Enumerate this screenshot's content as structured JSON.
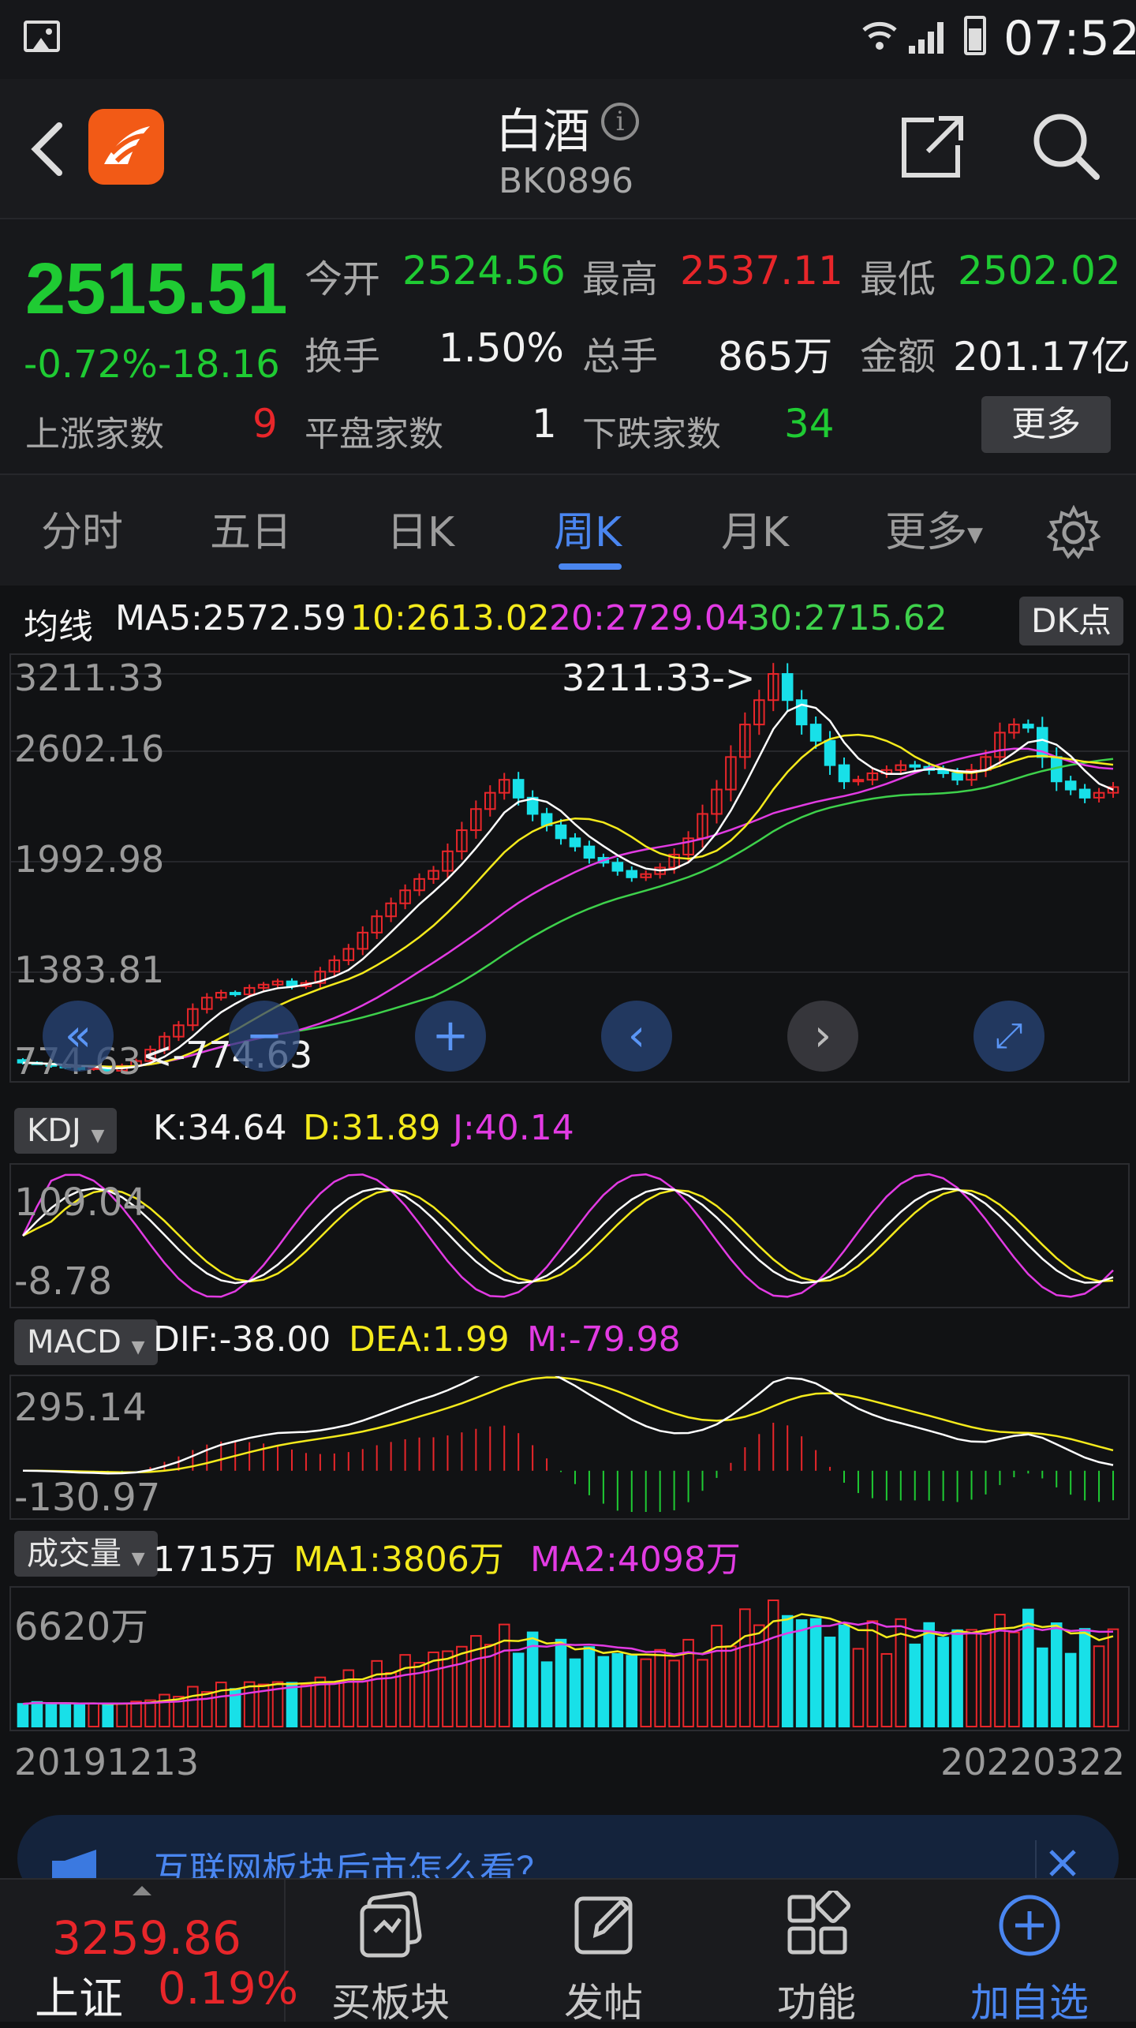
{
  "status": {
    "time": "07:52"
  },
  "header": {
    "title": "白酒",
    "code": "BK0896"
  },
  "quote": {
    "price": "2515.51",
    "change_pct": "-0.72%",
    "change_val": "-18.16",
    "open_label": "今开",
    "open": "2524.56",
    "high_label": "最高",
    "high": "2537.11",
    "low_label": "最低",
    "low": "2502.02",
    "turnover_label": "换手",
    "turnover": "1.50%",
    "volume_label": "总手",
    "volume": "865万",
    "amount_label": "金额",
    "amount": "201.17亿",
    "up_label": "上涨家数",
    "up": "9",
    "flat_label": "平盘家数",
    "flat": "1",
    "down_label": "下跌家数",
    "down": "34",
    "more_button": "更多"
  },
  "tabs": [
    "分时",
    "五日",
    "日K",
    "周K",
    "月K",
    "更多"
  ],
  "active_tab": "周K",
  "ma_legend": {
    "label": "均线",
    "ma5": "MA5:2572.59",
    "ma10": "10:2613.02",
    "ma20": "20:2729.04",
    "ma30": "30:2715.62",
    "dk_button": "DK点"
  },
  "kline": {
    "y_labels": [
      "3211.33",
      "2602.16",
      "1992.98",
      "1383.81",
      "774.63"
    ],
    "max_marker": "3211.33->",
    "min_marker": "<-774.63"
  },
  "kdj": {
    "selector": "KDJ",
    "k": "K:34.64",
    "d": "D:31.89",
    "j": "J:40.14",
    "y_labels": [
      "109.04",
      "-8.78"
    ]
  },
  "macd": {
    "selector": "MACD",
    "dif": "DIF:-38.00",
    "dea": "DEA:1.99",
    "m": "M:-79.98",
    "y_labels": [
      "295.14",
      "-130.97"
    ]
  },
  "vol": {
    "selector": "成交量",
    "value": "1715万",
    "ma1": "MA1:3806万",
    "ma2": "MA2:4098万",
    "y_label": "6620万"
  },
  "dates": {
    "start": "20191213",
    "end": "20220322"
  },
  "banner": {
    "text": "互联网板块后市怎么看？"
  },
  "bottom": {
    "index_value": "3259.86",
    "index_name": "上证",
    "index_change": "0.19%",
    "items": [
      "买板块",
      "发帖",
      "功能",
      "加自选"
    ]
  },
  "colors": {
    "up": "#e8262a",
    "down": "#1fcb33",
    "accent": "#4a86f0",
    "ma5": "#ffffff",
    "ma10": "#f4ea1c",
    "ma20": "#e23be3",
    "ma30": "#3ed14b",
    "vol_down": "#18e0e8"
  },
  "chart_data": {
    "type": "candlestick",
    "period": "weekly",
    "x_range": [
      "20191213",
      "20220322"
    ],
    "ylim": [
      774.63,
      3211.33
    ],
    "close_series_approx": [
      820,
      815,
      800,
      790,
      780,
      790,
      770,
      800,
      830,
      900,
      980,
      1050,
      1150,
      1220,
      1250,
      1240,
      1280,
      1300,
      1320,
      1290,
      1310,
      1380,
      1450,
      1520,
      1620,
      1720,
      1800,
      1880,
      1950,
      2000,
      2120,
      2250,
      2380,
      2480,
      2560,
      2450,
      2350,
      2280,
      2200,
      2150,
      2080,
      2050,
      2000,
      1960,
      1980,
      2020,
      2100,
      2200,
      2350,
      2500,
      2700,
      2900,
      3050,
      3211,
      3050,
      2900,
      2800,
      2650,
      2550,
      2560,
      2600,
      2620,
      2650,
      2640,
      2620,
      2600,
      2560,
      2620,
      2700,
      2850,
      2900,
      2880,
      2700,
      2550,
      2500,
      2450,
      2480,
      2515
    ]
  }
}
